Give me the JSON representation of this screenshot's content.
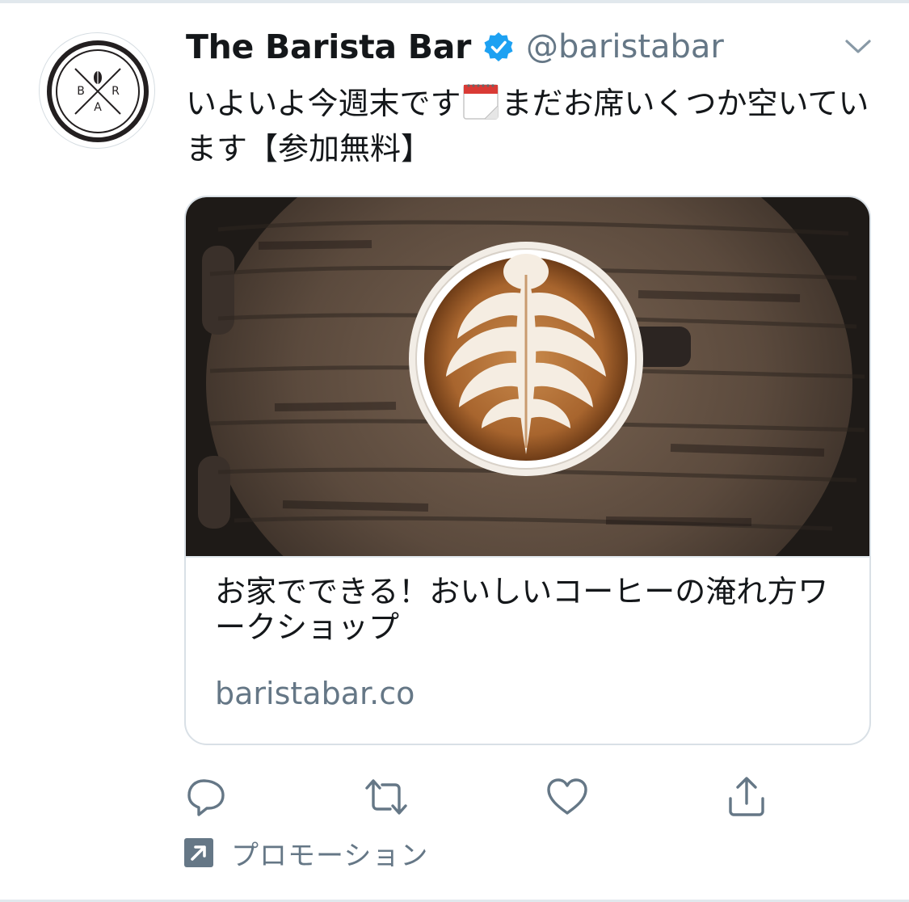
{
  "tweet": {
    "author_name": "The Barista Bar",
    "author_handle": "@baristabar",
    "text_part1": "いよいよ今週末です",
    "text_part2": "まだお席いくつか空いています【参加無料】",
    "avatar_logo": {
      "letter_left": "B",
      "letter_right": "R",
      "letter_bottom": "A"
    }
  },
  "card": {
    "title": "お家でできる！おいしいコーヒーの淹れ方ワークショップ",
    "domain": "baristabar.co"
  },
  "actions": {
    "reply_icon": "reply-icon",
    "retweet_icon": "retweet-icon",
    "like_icon": "heart-icon",
    "share_icon": "share-icon"
  },
  "promoted": {
    "label": "プロモーション"
  },
  "colors": {
    "verified": "#1da1f2",
    "secondary_text": "#657786",
    "primary_text": "#14171a",
    "border": "#e1e8ed"
  }
}
